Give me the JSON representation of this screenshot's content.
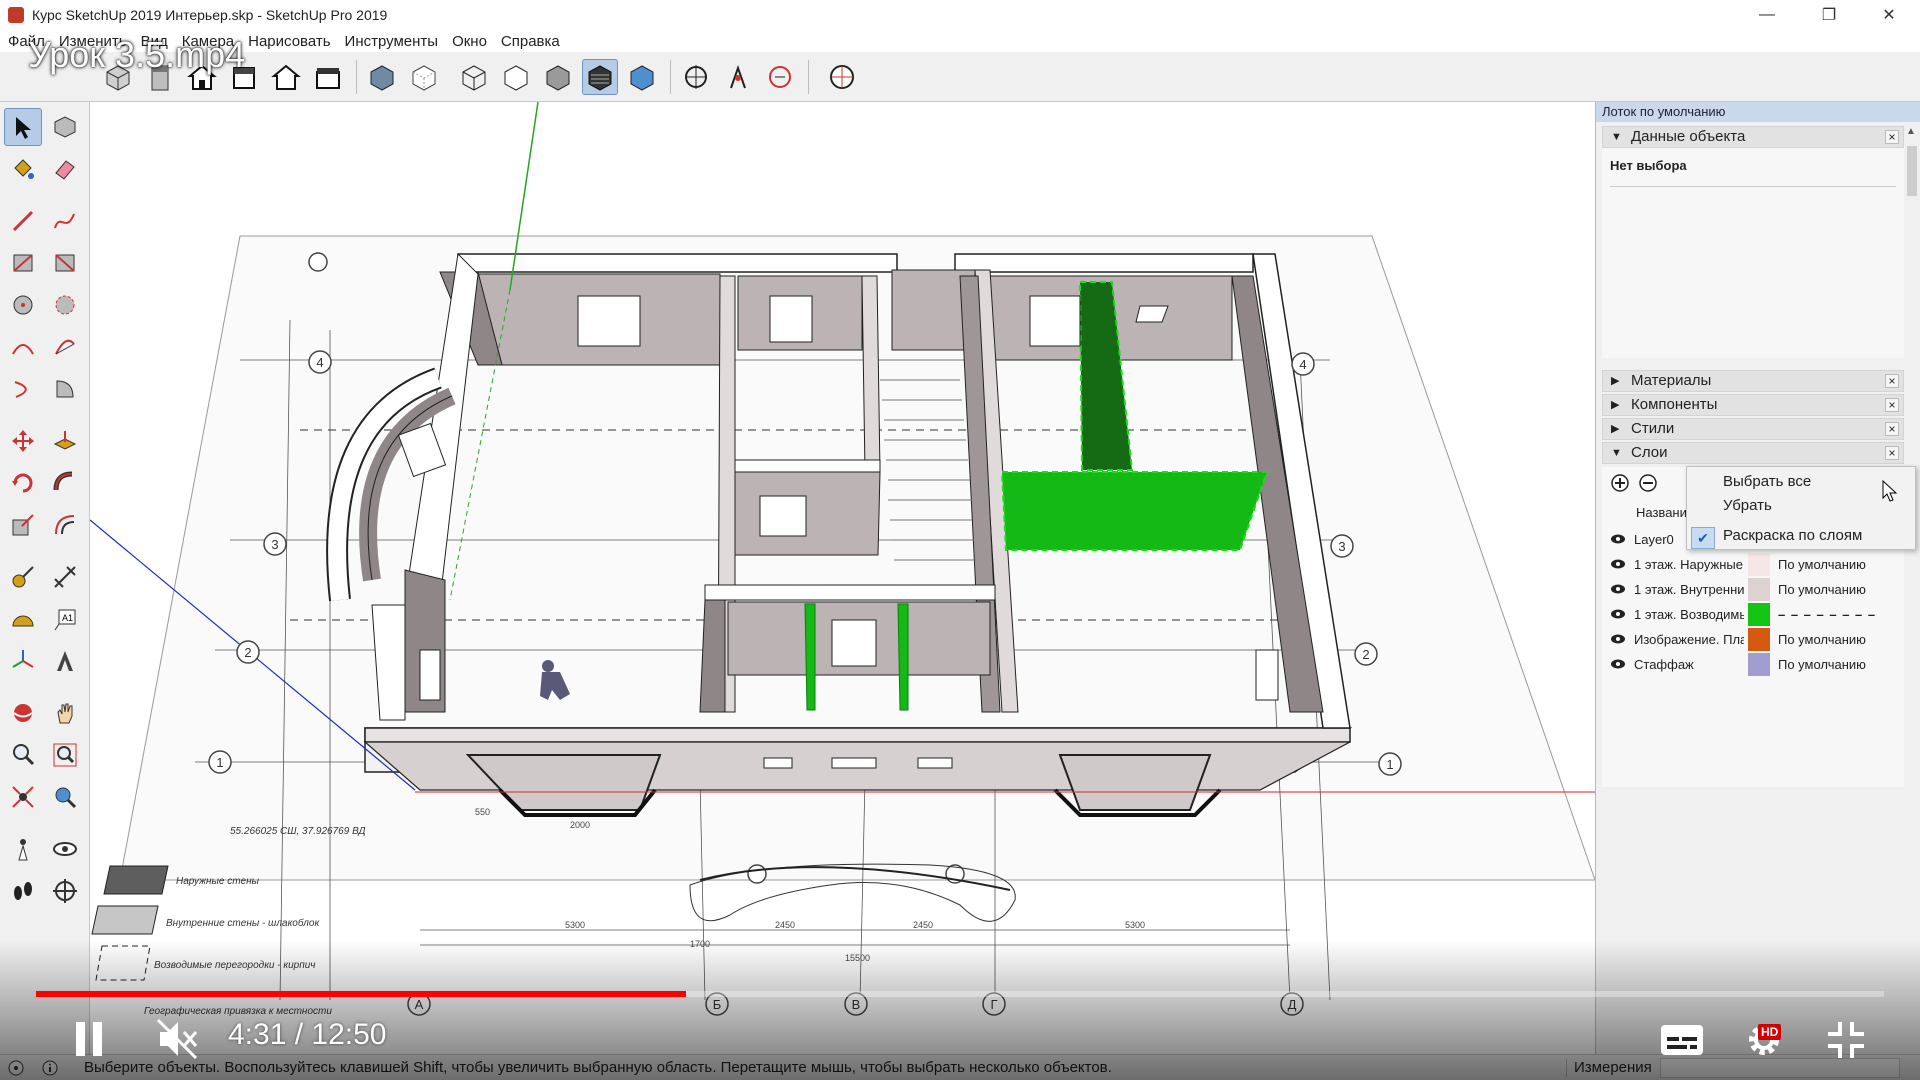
{
  "window": {
    "title": "Курс SketchUp 2019 Интерьер.skp - SketchUp Pro 2019",
    "min": "—",
    "restore": "❐",
    "close": "✕"
  },
  "menu": {
    "items": [
      "Файл",
      "Изменить",
      "Вид",
      "Камера",
      "Нарисовать",
      "Инструменты",
      "Окно",
      "Справка"
    ]
  },
  "video": {
    "title": "Урок 3.5.mp4",
    "time": "4:31 / 12:50",
    "progress": 0.352,
    "hd": "HD"
  },
  "tray": {
    "title": "Лоток по умолчанию",
    "entity": {
      "label": "Данные объекта",
      "status": "Нет выбора"
    },
    "panels": [
      "Материалы",
      "Компоненты",
      "Стили",
      "Слои"
    ],
    "layers": {
      "header": "Названи",
      "rows": [
        {
          "name": "Layer0",
          "color": "#ffffff",
          "dashes": ""
        },
        {
          "name": "1 этаж. Наружные",
          "color": "#f6e6e6",
          "dashes": "По умолчанию"
        },
        {
          "name": "1 этаж. Внутренни",
          "color": "#dcd2d2",
          "dashes": "По умолчанию"
        },
        {
          "name": "1 этаж. Возводимь",
          "color": "#15c315",
          "dashes": "– – – – – – – –"
        },
        {
          "name": "Изображение. Пла",
          "color": "#d45a12",
          "dashes": "По умолчанию"
        },
        {
          "name": "Стаффаж",
          "color": "#a19dd1",
          "dashes": "По умолчанию"
        }
      ]
    },
    "context_menu": [
      "Выбрать все",
      "Убрать",
      "Раскраска по слоям"
    ]
  },
  "viewport": {
    "labels": {
      "coords": "55.266025 СШ, 37.926769 ВД",
      "legend_outer": "Наружные стены",
      "legend_inner": "Внутренние стены - шлакоблок",
      "legend_partitions": "Возводимые перегородки - кирпич",
      "legend_geo": "Географическая привязка к местности",
      "axis_a": "А",
      "axis_b": "Б",
      "axis_v": "В",
      "axis_g": "Г",
      "axis_d": "Д",
      "axis_1": "1",
      "axis_2": "2",
      "axis_3": "3",
      "axis_4": "4",
      "dim_5300": "5300",
      "dim_2450": "2450",
      "dim_15500": "15500",
      "dim_2000": "2000",
      "dim_1700": "1700",
      "dim_550": "550"
    }
  },
  "status": {
    "message": "Выберите объекты. Воспользуйтесь клавишей Shift, чтобы увеличить выбранную область. Перетащите мышь, чтобы выбрать несколько объектов.",
    "measure": "Измерения"
  }
}
